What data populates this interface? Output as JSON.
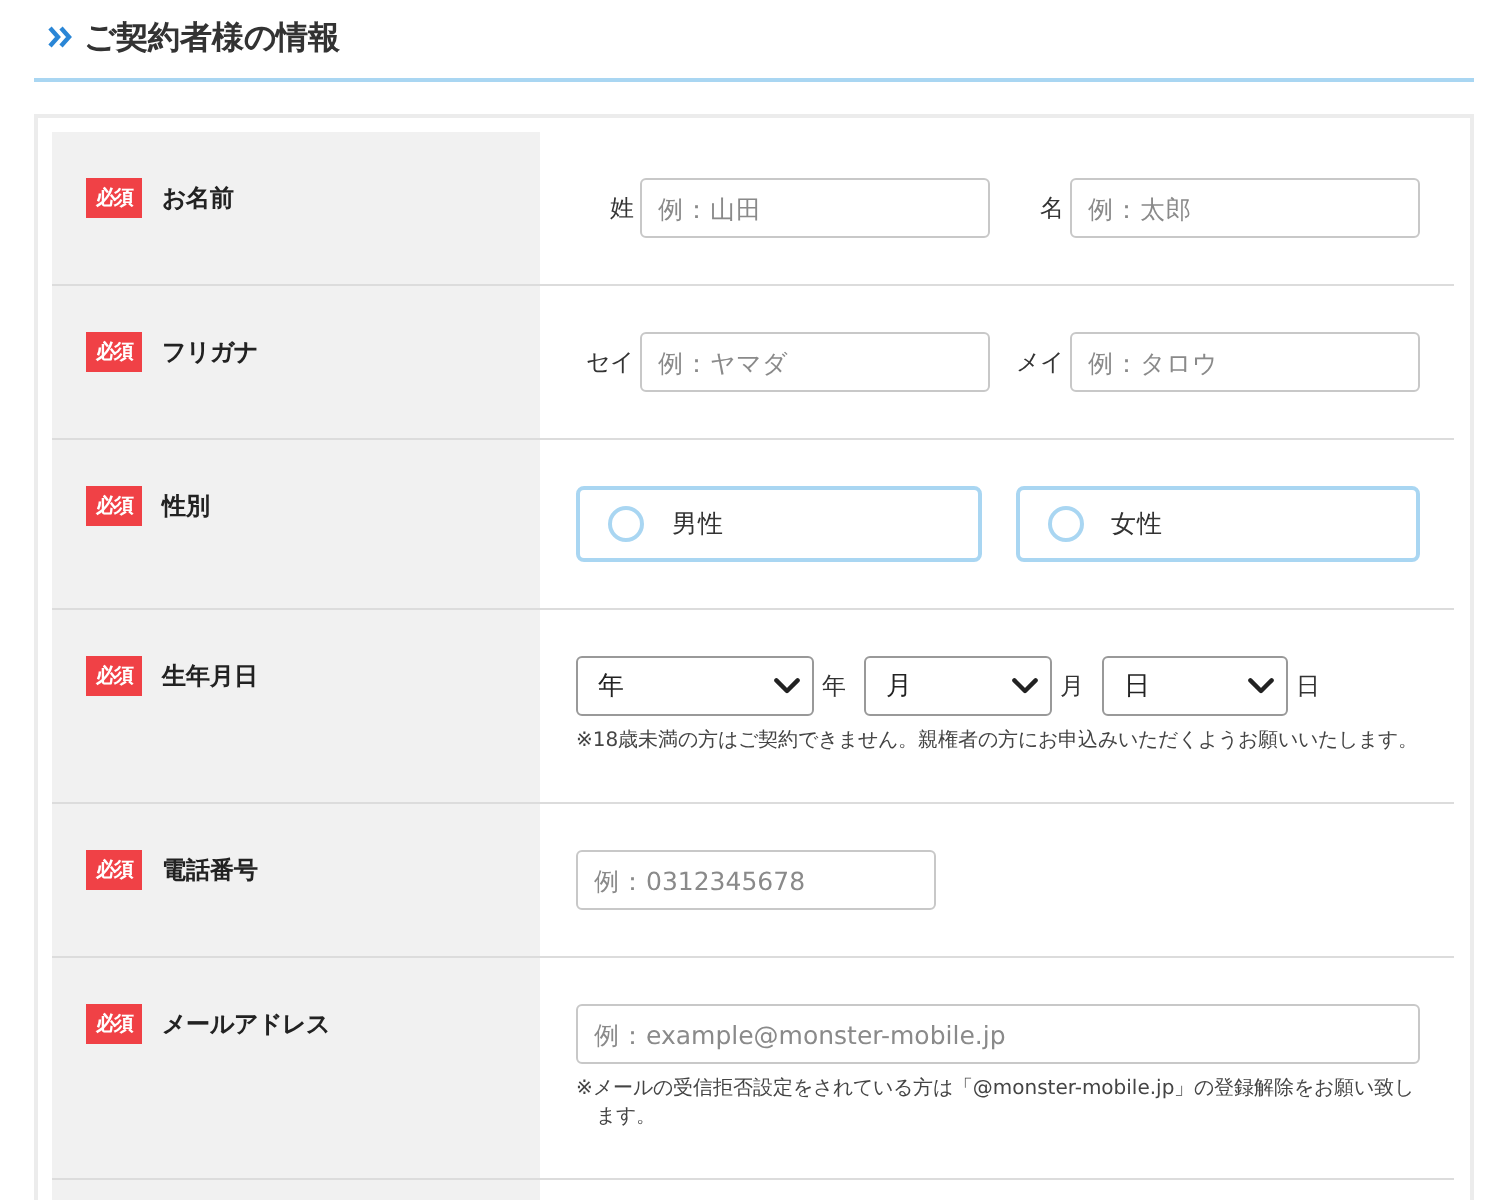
{
  "section": {
    "title": "ご契約者様の情報"
  },
  "form": {
    "rows": [
      {
        "kind": "name_pair",
        "label": "お名前",
        "badge": "必須",
        "fields": [
          {
            "prefix": "姓",
            "placeholder": "例：山田"
          },
          {
            "prefix": "名",
            "placeholder": "例：太郎"
          }
        ]
      },
      {
        "kind": "name_pair",
        "label": "フリガナ",
        "badge": "必須",
        "fields": [
          {
            "prefix": "セイ",
            "placeholder": "例：ヤマダ"
          },
          {
            "prefix": "メイ",
            "placeholder": "例：タロウ"
          }
        ]
      },
      {
        "kind": "radio",
        "label": "性別",
        "badge": "必須",
        "options": [
          {
            "label": "男性",
            "selected": false
          },
          {
            "label": "女性",
            "selected": false
          }
        ]
      },
      {
        "kind": "date",
        "label": "生年月日",
        "badge": "必須",
        "selects": [
          {
            "value": "年",
            "suffix": "年"
          },
          {
            "value": "月",
            "suffix": "月"
          },
          {
            "value": "日",
            "suffix": "日"
          }
        ],
        "note": "※18歳未満の方はご契約できません。親権者の方にお申込みいただくようお願いいたします。"
      },
      {
        "kind": "phone",
        "label": "電話番号",
        "badge": "必須",
        "placeholder": "例：0312345678"
      },
      {
        "kind": "email",
        "label": "メールアドレス",
        "badge": "必須",
        "placeholder": "例：example@monster-mobile.jp",
        "note": "※メールの受信拒否設定をされている方は「@monster-mobile.jp」の登録解除をお願い致します。"
      }
    ]
  }
}
